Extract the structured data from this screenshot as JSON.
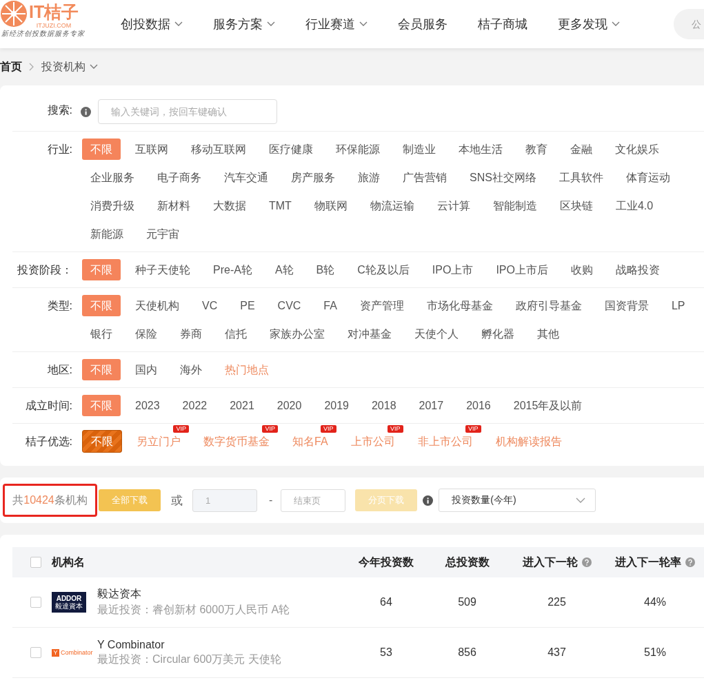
{
  "header": {
    "logo": {
      "brand": "IT桔子",
      "domain": "ITJUZI.COM",
      "tagline": "新经济创投数据服务专家"
    },
    "nav": [
      {
        "label": "创投数据",
        "dropdown": true
      },
      {
        "label": "服务方案",
        "dropdown": true
      },
      {
        "label": "行业赛道",
        "dropdown": true
      },
      {
        "label": "会员服务",
        "dropdown": false
      },
      {
        "label": "桔子商城",
        "dropdown": false
      },
      {
        "label": "更多发现",
        "dropdown": true
      }
    ],
    "search": {
      "placeholder": "公"
    }
  },
  "breadcrumb": [
    {
      "label": "首页",
      "current": false
    },
    {
      "label": "投资机构",
      "current": true
    }
  ],
  "filters": {
    "search": {
      "label": "搜索:",
      "placeholder": "输入关键词，按回车键确认"
    },
    "rows": [
      {
        "label": "行业:",
        "premium": false,
        "lines": [
          [
            {
              "label": "不限",
              "selected": true
            },
            {
              "label": "互联网",
              "selected": false
            },
            {
              "label": "移动互联网",
              "selected": false
            },
            {
              "label": "医疗健康",
              "selected": false
            },
            {
              "label": "环保能源",
              "selected": false
            },
            {
              "label": "制造业",
              "selected": false
            },
            {
              "label": "本地生活",
              "selected": false
            },
            {
              "label": "教育",
              "selected": false
            },
            {
              "label": "金融",
              "selected": false
            },
            {
              "label": "文化娱乐",
              "selected": false
            }
          ],
          [
            {
              "label": "企业服务",
              "selected": false
            },
            {
              "label": "电子商务",
              "selected": false
            },
            {
              "label": "汽车交通",
              "selected": false
            },
            {
              "label": "房产服务",
              "selected": false
            },
            {
              "label": "旅游",
              "selected": false
            },
            {
              "label": "广告营销",
              "selected": false
            },
            {
              "label": "SNS社交网络",
              "selected": false
            },
            {
              "label": "工具软件",
              "selected": false
            },
            {
              "label": "体育运动",
              "selected": false
            }
          ],
          [
            {
              "label": "消费升级",
              "selected": false
            },
            {
              "label": "新材料",
              "selected": false
            },
            {
              "label": "大数据",
              "selected": false
            },
            {
              "label": "TMT",
              "selected": false
            },
            {
              "label": "物联网",
              "selected": false
            },
            {
              "label": "物流运输",
              "selected": false
            },
            {
              "label": "云计算",
              "selected": false
            },
            {
              "label": "智能制造",
              "selected": false
            },
            {
              "label": "区块链",
              "selected": false
            },
            {
              "label": "工业4.0",
              "selected": false
            }
          ],
          [
            {
              "label": "新能源",
              "selected": false
            },
            {
              "label": "元宇宙",
              "selected": false
            }
          ]
        ]
      },
      {
        "label": "投资阶段：",
        "premium": false,
        "lines": [
          [
            {
              "label": "不限",
              "selected": true
            },
            {
              "label": "种子天使轮",
              "selected": false
            },
            {
              "label": "Pre-A轮",
              "selected": false
            },
            {
              "label": "A轮",
              "selected": false
            },
            {
              "label": "B轮",
              "selected": false
            },
            {
              "label": "C轮及以后",
              "selected": false
            },
            {
              "label": "IPO上市",
              "selected": false
            },
            {
              "label": "IPO上市后",
              "selected": false
            },
            {
              "label": "收购",
              "selected": false
            },
            {
              "label": "战略投资",
              "selected": false
            }
          ]
        ]
      },
      {
        "label": "类型:",
        "premium": false,
        "lines": [
          [
            {
              "label": "不限",
              "selected": true
            },
            {
              "label": "天使机构",
              "selected": false
            },
            {
              "label": "VC",
              "selected": false
            },
            {
              "label": "PE",
              "selected": false
            },
            {
              "label": "CVC",
              "selected": false
            },
            {
              "label": "FA",
              "selected": false
            },
            {
              "label": "资产管理",
              "selected": false
            },
            {
              "label": "市场化母基金",
              "selected": false
            },
            {
              "label": "政府引导基金",
              "selected": false
            },
            {
              "label": "国资背景",
              "selected": false
            },
            {
              "label": "LP",
              "selected": false
            }
          ],
          [
            {
              "label": "银行",
              "selected": false
            },
            {
              "label": "保险",
              "selected": false
            },
            {
              "label": "券商",
              "selected": false
            },
            {
              "label": "信托",
              "selected": false
            },
            {
              "label": "家族办公室",
              "selected": false
            },
            {
              "label": "对冲基金",
              "selected": false
            },
            {
              "label": "天使个人",
              "selected": false
            },
            {
              "label": "孵化器",
              "selected": false
            },
            {
              "label": "其他",
              "selected": false
            }
          ]
        ]
      },
      {
        "label": "地区:",
        "premium": false,
        "lines": [
          [
            {
              "label": "不限",
              "selected": true
            },
            {
              "label": "国内",
              "selected": false
            },
            {
              "label": "海外",
              "selected": false
            },
            {
              "label": "热门地点",
              "selected": false,
              "highlight": true
            }
          ]
        ]
      },
      {
        "label": "成立时间:",
        "premium": false,
        "lines": [
          [
            {
              "label": "不限",
              "selected": true
            },
            {
              "label": "2023",
              "selected": false
            },
            {
              "label": "2022",
              "selected": false
            },
            {
              "label": "2021",
              "selected": false
            },
            {
              "label": "2020",
              "selected": false
            },
            {
              "label": "2019",
              "selected": false
            },
            {
              "label": "2018",
              "selected": false
            },
            {
              "label": "2017",
              "selected": false
            },
            {
              "label": "2016",
              "selected": false
            },
            {
              "label": "2015年及以前",
              "selected": false
            }
          ]
        ]
      },
      {
        "label": "桔子优选:",
        "premium": true,
        "lines": [
          [
            {
              "label": "不限",
              "selected": true
            },
            {
              "label": "另立门户",
              "selected": false,
              "highlight": true,
              "vip": "VIP"
            },
            {
              "label": "数字货币基金",
              "selected": false,
              "highlight": true,
              "vip": "VIP"
            },
            {
              "label": "知名FA",
              "selected": false,
              "highlight": true,
              "vip": "VIP"
            },
            {
              "label": "上市公司",
              "selected": false,
              "highlight": true,
              "vip": "VIP"
            },
            {
              "label": "非上市公司",
              "selected": false,
              "highlight": true,
              "vip": "VIP"
            },
            {
              "label": "机构解读报告",
              "selected": false,
              "highlight": true
            }
          ]
        ]
      }
    ]
  },
  "toolbar": {
    "count": {
      "prefix": "共",
      "number": "10424",
      "suffix": "条机构",
      "outlined": true
    },
    "download_all": "全部下载",
    "or": "或",
    "start_page": {
      "value": "1",
      "disabled": true
    },
    "dash": "-",
    "end_page": {
      "placeholder": "结束页"
    },
    "download_pages": {
      "label": "分页下载",
      "disabled": true
    },
    "sort": {
      "value": "投资数量(今年)"
    }
  },
  "table": {
    "all_checked": false,
    "columns": [
      {
        "label": "机构名",
        "help": false
      },
      {
        "label": "今年投资数",
        "help": false
      },
      {
        "label": "总投资数",
        "help": false
      },
      {
        "label": "进入下一轮",
        "help": true
      },
      {
        "label": "进入下一轮率",
        "help": true
      }
    ],
    "rows": [
      {
        "checked": false,
        "logo": {
          "kind": "addor",
          "text": "ADDOR",
          "subtext": "毅達資本"
        },
        "name": "毅达资本",
        "recent": "最近投资：睿创新材 6000万人民币 A轮",
        "this_year": "64",
        "total": "509",
        "next_round": "225",
        "next_rate": "44%"
      },
      {
        "checked": false,
        "logo": {
          "kind": "yc",
          "text": "Combinator",
          "subtext": "Y"
        },
        "name": "Y Combinator",
        "recent": "最近投资：Circular 600万美元 天使轮",
        "this_year": "53",
        "total": "856",
        "next_round": "437",
        "next_rate": "51%"
      }
    ]
  }
}
